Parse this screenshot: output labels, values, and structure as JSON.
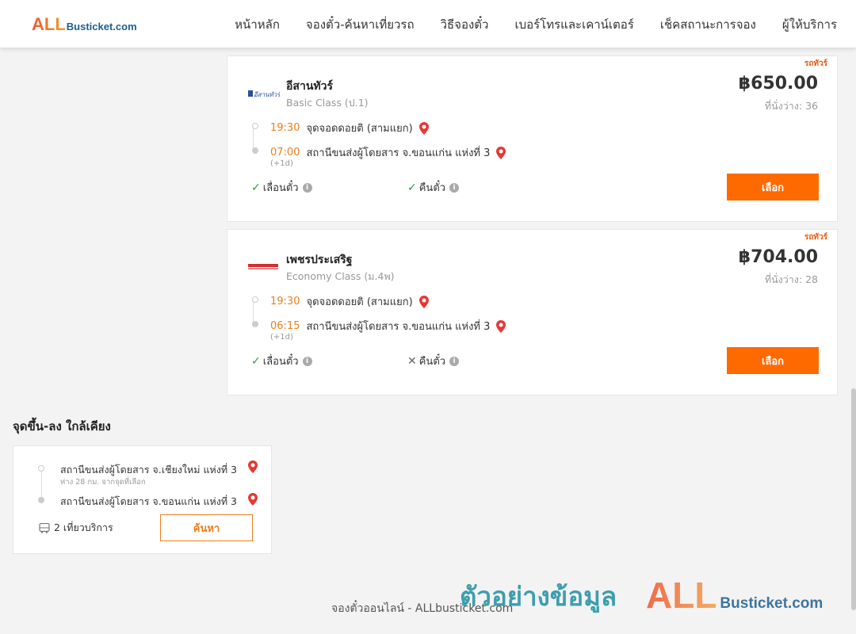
{
  "header": {
    "logo_all": "ALL",
    "logo_rest": "Busticket.com",
    "nav": [
      "หน้าหลัก",
      "จองตั๋ว-ค้นหาเที่ยวรถ",
      "วิธีจองตั๋ว",
      "เบอร์โทรและเคาน์เตอร์",
      "เช็คสถานะการจอง",
      "ผู้ให้บริการ"
    ]
  },
  "trips": [
    {
      "tag": "รถทัวร์",
      "operator": "อีสานทัวร์",
      "class": "Basic Class (ป.1)",
      "price": "฿650.00",
      "seats": "ที่นั่งว่าง: 36",
      "depart_time": "19:30",
      "depart_place": "จุดจอดดอยติ (สามแยก)",
      "arrive_time": "07:00",
      "arrive_place": "สถานีขนส่งผู้โดยสาร จ.ขอนแก่น แห่งที่ 3",
      "next_day": "(+1d)",
      "feature1": "เลื่อนตั๋ว",
      "feature1_ok": true,
      "feature2": "คืนตั๋ว",
      "feature2_ok": true,
      "button": "เลือก",
      "logo_color": "#2a4f9e"
    },
    {
      "tag": "รถทัวร์",
      "operator": "เพชรประเสริฐ",
      "class": "Economy Class (ม.4พ)",
      "price": "฿704.00",
      "seats": "ที่นั่งว่าง: 28",
      "depart_time": "19:30",
      "depart_place": "จุดจอดดอยติ (สามแยก)",
      "arrive_time": "06:15",
      "arrive_place": "สถานีขนส่งผู้โดยสาร จ.ขอนแก่น แห่งที่ 3",
      "next_day": "(+1d)",
      "feature1": "เลื่อนตั๋ว",
      "feature1_ok": true,
      "feature2": "คืนตั๋ว",
      "feature2_ok": false,
      "button": "เลือก",
      "logo_color": "#d32f2f"
    }
  ],
  "nearby": {
    "title": "จุดขึ้น-ลง ใกล้เคียง",
    "from_station": "สถานีขนส่งผู้โดยสาร จ.เชียงใหม่ แห่งที่ 3",
    "from_distance": "ห่าง 28 กม. จากจุดที่เลือก",
    "to_station": "สถานีขนส่งผู้โดยสาร จ.ขอนแก่น แห่งที่ 3",
    "trips_count": "2 เที่ยวบริการ",
    "search_button": "ค้นหา"
  },
  "footer": {
    "text": "จองตั๋วออนไลน์ - ALLbusticket.com"
  },
  "watermark": {
    "thai": "ตัวอย่างข้อมูล",
    "logo_all": "ALL",
    "logo_rest": "Busticket.com"
  },
  "colors": {
    "accent": "#ff6a00",
    "time": "#f07d1a",
    "check": "#2e9b3e"
  }
}
